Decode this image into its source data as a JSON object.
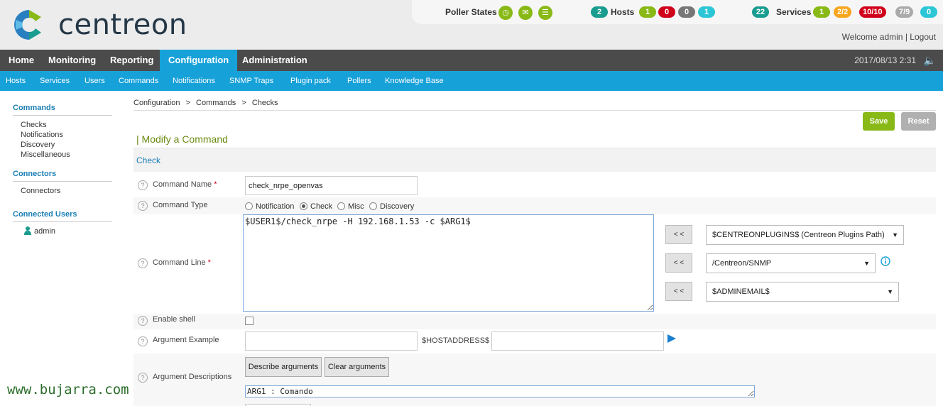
{
  "brand": {
    "name": "centreon"
  },
  "poller": {
    "label": "Poller States"
  },
  "hosts": {
    "label": "Hosts",
    "total": "2",
    "up": "1",
    "down": "0",
    "unreachable": "0",
    "pending": "1"
  },
  "services": {
    "label": "Services",
    "total": "22",
    "ok": "1",
    "warning": "2/2",
    "critical": "10/10",
    "unknown": "7/9",
    "pending": "0"
  },
  "user": {
    "welcome": "Welcome admin",
    "separator": "|",
    "logout": "Logout"
  },
  "main_nav": [
    "Home",
    "Monitoring",
    "Reporting",
    "Configuration",
    "Administration"
  ],
  "clock": "2017/08/13 2:31",
  "sub_nav": [
    "Hosts",
    "Services",
    "Users",
    "Commands",
    "Notifications",
    "SNMP Traps",
    "Plugin pack",
    "Pollers",
    "Knowledge Base"
  ],
  "sidebar": {
    "commands_title": "Commands",
    "commands_items": [
      "Checks",
      "Notifications",
      "Discovery",
      "Miscellaneous"
    ],
    "connectors_title": "Connectors",
    "connectors_items": [
      "Connectors"
    ],
    "users_title": "Connected Users",
    "users_items": [
      "admin"
    ]
  },
  "breadcrumb": [
    "Configuration",
    "Commands",
    "Checks"
  ],
  "breadcrumb_sep": ">",
  "actions": {
    "save": "Save",
    "reset": "Reset"
  },
  "page_title": "| Modify a Command",
  "section_title": "Check",
  "form": {
    "name_label": "Command Name",
    "required_mark": "*",
    "name_value": "check_nrpe_openvas",
    "type_label": "Command Type",
    "types": [
      "Notification",
      "Check",
      "Misc",
      "Discovery"
    ],
    "type_selected": "Check",
    "line_label": "Command Line",
    "line_value": "$USER1$/check_nrpe -H 192.168.1.53 -c $ARG1$",
    "insert_btn": "< <",
    "macro_select_1": "$CENTREONPLUGINS$ (Centreon Plugins Path)",
    "macro_select_2": "/Centreon/SNMP",
    "macro_select_3": "$ADMINEMAIL$",
    "shell_label": "Enable shell",
    "shell_checked": false,
    "example_label": "Argument Example",
    "example_value": "",
    "hostaddress_label": "$HOSTADDRESS$",
    "hostaddress_value": "",
    "desc_label": "Argument Descriptions",
    "describe_btn": "Describe arguments",
    "clear_btn": "Clear arguments",
    "desc_value": "ARG1 : Comando"
  },
  "colors": {
    "green": "#88b917",
    "blue": "#17a1d9",
    "dark_nav": "#4b4b4b",
    "red": "#d0021b",
    "orange": "#f7a51c",
    "grey": "#999999",
    "cyan": "#2cc6d6",
    "teal": "#1a9c8f"
  },
  "watermark": "www.bujarra.com"
}
